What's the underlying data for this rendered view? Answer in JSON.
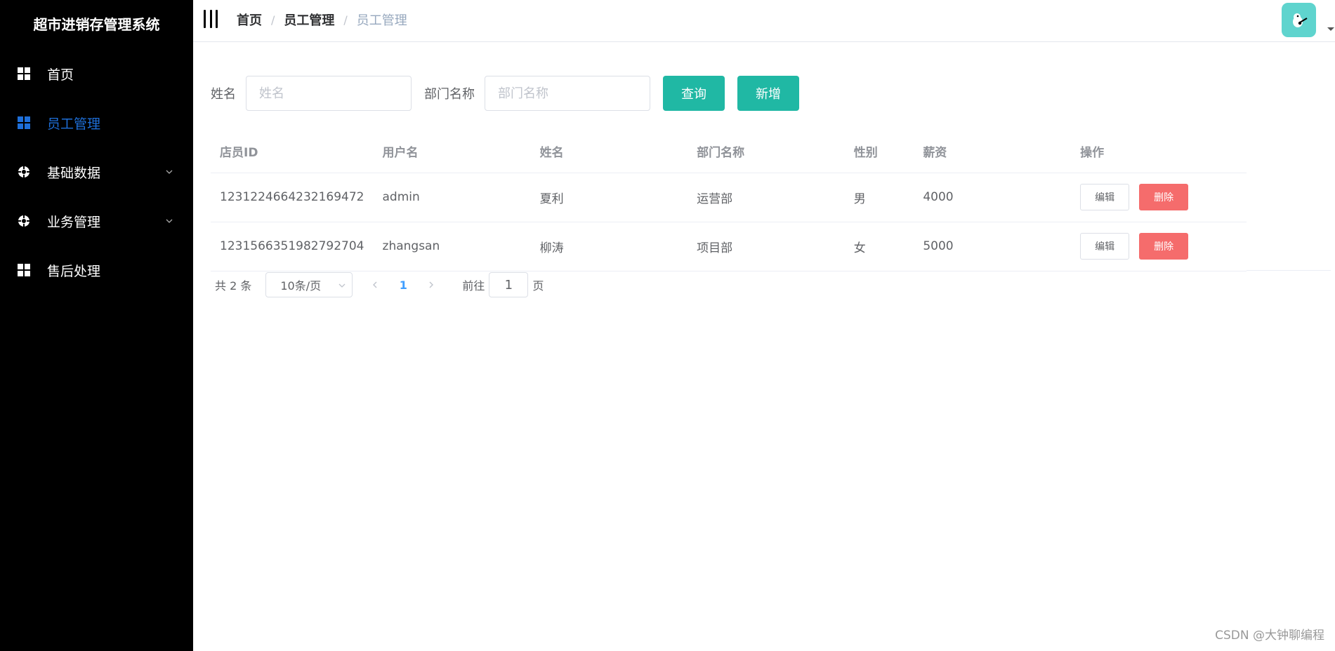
{
  "app": {
    "title": "超市进销存管理系统"
  },
  "sidebar": {
    "items": [
      {
        "label": "首页",
        "icon": "grid-icon"
      },
      {
        "label": "员工管理",
        "icon": "grid-icon"
      },
      {
        "label": "基础数据",
        "icon": "circle-cog-icon"
      },
      {
        "label": "业务管理",
        "icon": "circle-cog-icon"
      },
      {
        "label": "售后处理",
        "icon": "grid-icon"
      }
    ]
  },
  "breadcrumb": [
    "首页",
    "员工管理",
    "员工管理"
  ],
  "search": {
    "name_label": "姓名",
    "name_placeholder": "姓名",
    "dept_label": "部门名称",
    "dept_placeholder": "部门名称",
    "query_label": "查询",
    "add_label": "新增"
  },
  "table": {
    "headers": [
      "店员ID",
      "用户名",
      "姓名",
      "部门名称",
      "性别",
      "薪资",
      "操作"
    ],
    "rows": [
      [
        "1231224664232169472",
        "admin",
        "夏利",
        "运营部",
        "男",
        "4000"
      ],
      [
        "1231566351982792704",
        "zhangsan",
        "柳涛",
        "项目部",
        "女",
        "5000"
      ]
    ],
    "edit_label": "编辑",
    "delete_label": "删除"
  },
  "pagination": {
    "total": "共 2 条",
    "page_size": "10条/页",
    "current_page": "1",
    "goto_prefix": "前往",
    "goto_value": "1",
    "goto_suffix": "页"
  },
  "watermark": "CSDN @大钟聊编程",
  "colors": {
    "sidebar_bg": "#000000",
    "active_menu": "#1e6fd9",
    "primary_teal": "#20b8a4",
    "danger": "#f56c6c",
    "pagination_active": "#409eff"
  }
}
